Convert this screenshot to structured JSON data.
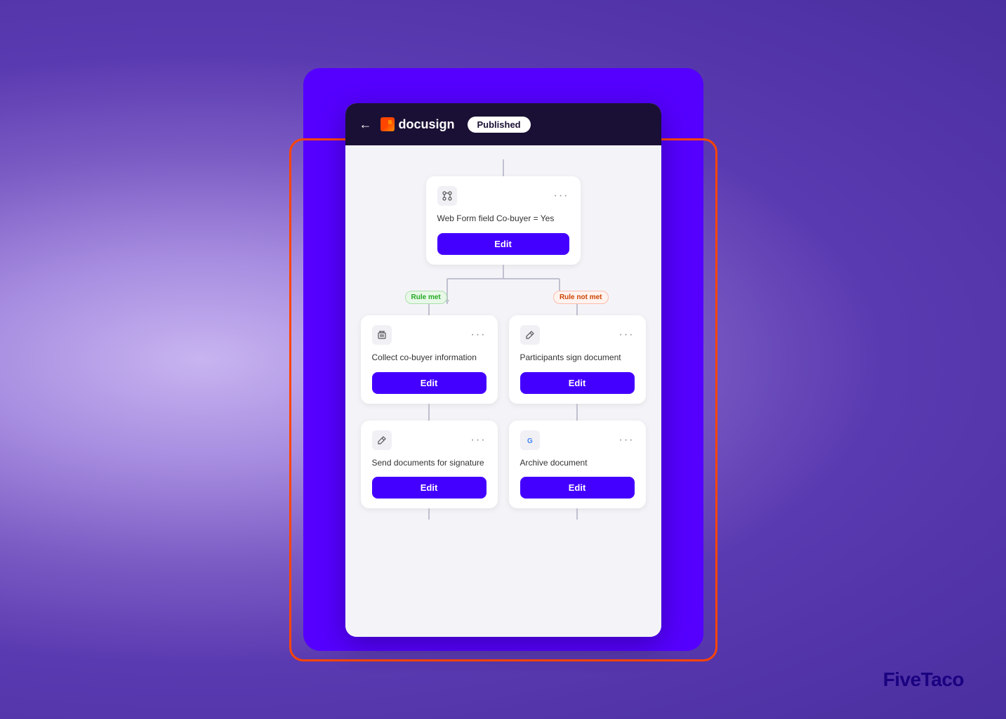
{
  "brand": {
    "name": "FiveTaco",
    "first": "Five",
    "second": "Taco"
  },
  "header": {
    "back_label": "←",
    "app_name": "docusign",
    "status_badge": "Published"
  },
  "flow": {
    "condition_card": {
      "label": "Web Form field Co-buyer = Yes",
      "edit_btn": "Edit",
      "more": "···"
    },
    "branch_left": {
      "badge": "Rule met",
      "card1": {
        "label": "Collect co-buyer information",
        "edit_btn": "Edit",
        "more": "···",
        "icon_type": "trash"
      },
      "card2": {
        "label": "Send documents for signature",
        "edit_btn": "Edit",
        "more": "···",
        "icon_type": "pen"
      }
    },
    "branch_right": {
      "badge": "Rule not met",
      "card1": {
        "label": "Participants sign document",
        "edit_btn": "Edit",
        "more": "···",
        "icon_type": "pen"
      },
      "card2": {
        "label": "Archive document",
        "edit_btn": "Edit",
        "more": "···",
        "icon_type": "google"
      }
    }
  }
}
